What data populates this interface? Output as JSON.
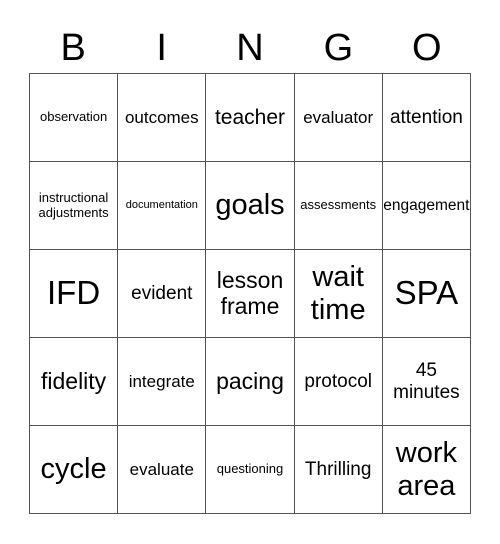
{
  "header": {
    "letters": [
      "B",
      "I",
      "N",
      "G",
      "O"
    ]
  },
  "board": {
    "rows": [
      [
        "observation",
        "outcomes",
        "teacher",
        "evaluator",
        "attention"
      ],
      [
        "instructional adjustments",
        "documentation",
        "goals",
        "assessments",
        "engagement"
      ],
      [
        "IFD",
        "evident",
        "lesson frame",
        "wait time",
        "SPA"
      ],
      [
        "fidelity",
        "integrate",
        "pacing",
        "protocol",
        "45 minutes"
      ],
      [
        "cycle",
        "evaluate",
        "questioning",
        "Thrilling",
        "work area"
      ]
    ]
  }
}
